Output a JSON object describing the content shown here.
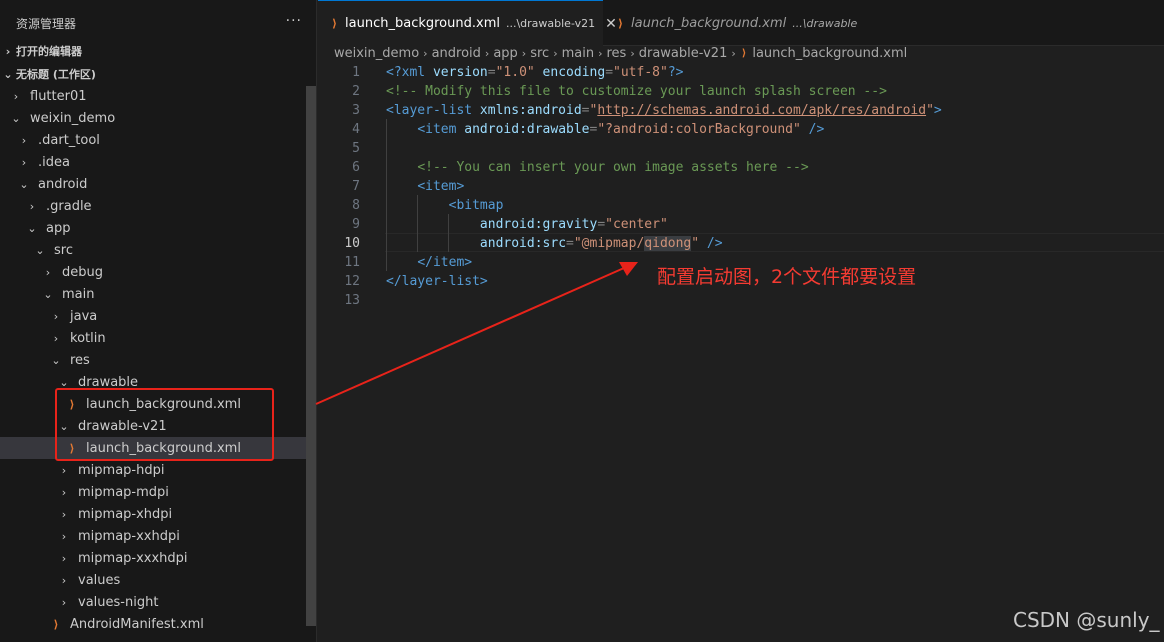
{
  "sidebar": {
    "title": "资源管理器",
    "more": "···",
    "open_editors": "打开的编辑器",
    "workspace": "无标题 (工作区)",
    "tree": [
      {
        "label": "flutter01",
        "indent": 0,
        "chev": "›"
      },
      {
        "label": "weixin_demo",
        "indent": 0,
        "chev": "⌄"
      },
      {
        "label": ".dart_tool",
        "indent": 1,
        "chev": "›"
      },
      {
        "label": ".idea",
        "indent": 1,
        "chev": "›"
      },
      {
        "label": "android",
        "indent": 1,
        "chev": "⌄"
      },
      {
        "label": ".gradle",
        "indent": 2,
        "chev": "›"
      },
      {
        "label": "app",
        "indent": 2,
        "chev": "⌄"
      },
      {
        "label": "src",
        "indent": 3,
        "chev": "⌄"
      },
      {
        "label": "debug",
        "indent": 4,
        "chev": "›"
      },
      {
        "label": "main",
        "indent": 4,
        "chev": "⌄"
      },
      {
        "label": "java",
        "indent": 5,
        "chev": "›"
      },
      {
        "label": "kotlin",
        "indent": 5,
        "chev": "›"
      },
      {
        "label": "res",
        "indent": 5,
        "chev": "⌄"
      },
      {
        "label": "drawable",
        "indent": 6,
        "chev": "⌄"
      },
      {
        "label": "launch_background.xml",
        "indent": 7,
        "file": true
      },
      {
        "label": "drawable-v21",
        "indent": 6,
        "chev": "⌄"
      },
      {
        "label": "launch_background.xml",
        "indent": 7,
        "file": true,
        "selected": true
      },
      {
        "label": "mipmap-hdpi",
        "indent": 6,
        "chev": "›"
      },
      {
        "label": "mipmap-mdpi",
        "indent": 6,
        "chev": "›"
      },
      {
        "label": "mipmap-xhdpi",
        "indent": 6,
        "chev": "›"
      },
      {
        "label": "mipmap-xxhdpi",
        "indent": 6,
        "chev": "›"
      },
      {
        "label": "mipmap-xxxhdpi",
        "indent": 6,
        "chev": "›"
      },
      {
        "label": "values",
        "indent": 6,
        "chev": "›"
      },
      {
        "label": "values-night",
        "indent": 6,
        "chev": "›"
      },
      {
        "label": "AndroidManifest.xml",
        "indent": 5,
        "file": true
      }
    ]
  },
  "tabs": [
    {
      "label": "launch_background.xml",
      "desc": "...\\drawable-v21",
      "close": "✕"
    },
    {
      "label": "launch_background.xml",
      "desc": "...\\drawable"
    }
  ],
  "breadcrumbs": [
    "weixin_demo",
    "android",
    "app",
    "src",
    "main",
    "res",
    "drawable-v21",
    "launch_background.xml"
  ],
  "editor": {
    "current_line": 10,
    "lines": [
      [
        [
          "<?",
          "t-tag"
        ],
        [
          "xml",
          "t-tag"
        ],
        [
          " version",
          "t-attr"
        ],
        [
          "=",
          "t-punc"
        ],
        [
          "\"1.0\"",
          "t-str"
        ],
        [
          " encoding",
          "t-attr"
        ],
        [
          "=",
          "t-punc"
        ],
        [
          "\"utf-8\"",
          "t-str"
        ],
        [
          "?>",
          "t-tag"
        ]
      ],
      [
        [
          "<!-- Modify this file to customize your launch splash screen -->",
          "t-cmt"
        ]
      ],
      [
        [
          "<layer-list",
          "t-tag"
        ],
        [
          " xmlns:android",
          "t-attr"
        ],
        [
          "=",
          "t-punc"
        ],
        [
          "\"",
          "t-str"
        ],
        [
          "http://schemas.android.com/apk/res/android",
          "t-url"
        ],
        [
          "\"",
          "t-str"
        ],
        [
          ">",
          "t-tag"
        ]
      ],
      [
        [
          "    ",
          ""
        ],
        [
          "<item",
          "t-tag"
        ],
        [
          " android:drawable",
          "t-attr"
        ],
        [
          "=",
          "t-punc"
        ],
        [
          "\"?android:colorBackground\"",
          "t-str"
        ],
        [
          " />",
          "t-tag"
        ]
      ],
      [
        [
          "",
          ""
        ]
      ],
      [
        [
          "    ",
          ""
        ],
        [
          "<!-- You can insert your own image assets here -->",
          "t-cmt"
        ]
      ],
      [
        [
          "    ",
          ""
        ],
        [
          "<item>",
          "t-tag"
        ]
      ],
      [
        [
          "        ",
          ""
        ],
        [
          "<bitmap",
          "t-tag"
        ]
      ],
      [
        [
          "            ",
          ""
        ],
        [
          "android:gravity",
          "t-attr"
        ],
        [
          "=",
          "t-punc"
        ],
        [
          "\"center\"",
          "t-str"
        ]
      ],
      [
        [
          "            ",
          ""
        ],
        [
          "android:src",
          "t-attr"
        ],
        [
          "=",
          "t-punc"
        ],
        [
          "\"@mipmap/",
          "t-str"
        ],
        [
          "qidong",
          "t-str t-hl"
        ],
        [
          "\"",
          "t-str"
        ],
        [
          " />",
          "t-tag"
        ]
      ],
      [
        [
          "    ",
          ""
        ],
        [
          "</item>",
          "t-tag"
        ]
      ],
      [
        [
          "</layer-list>",
          "t-tag"
        ]
      ],
      [
        [
          "",
          ""
        ]
      ]
    ]
  },
  "annotation": "配置启动图，2个文件都要设置",
  "watermark": "CSDN @sunly_",
  "colors": {
    "annotation_red": "#e8231a",
    "accent": "#0078d4"
  }
}
